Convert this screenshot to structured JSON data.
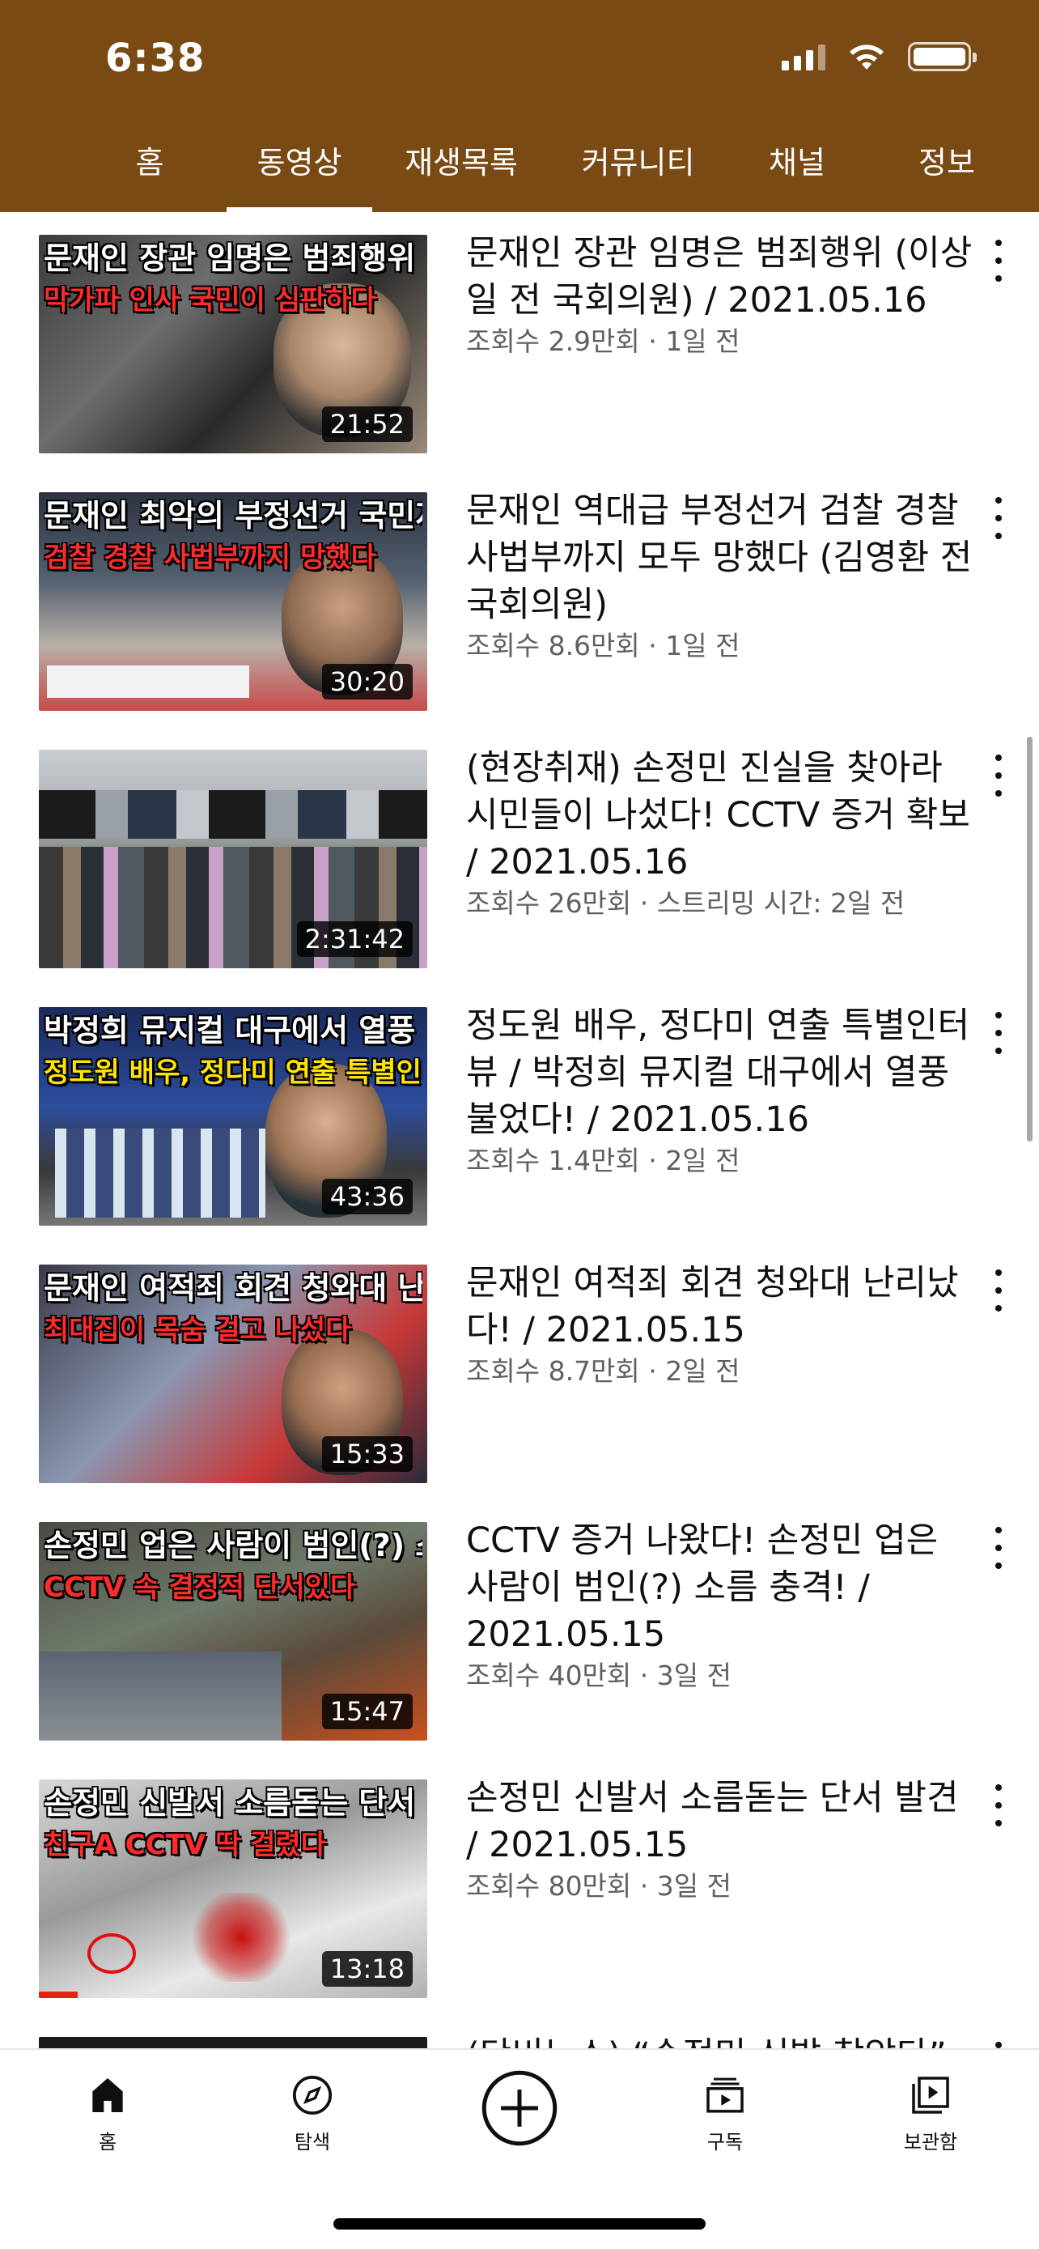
{
  "status_bar": {
    "time": "6:38"
  },
  "tabs": [
    {
      "label": "홈"
    },
    {
      "label": "동영상"
    },
    {
      "label": "재생목록"
    },
    {
      "label": "커뮤니티"
    },
    {
      "label": "채널"
    },
    {
      "label": "정보"
    }
  ],
  "active_tab": "동영상",
  "videos": [
    {
      "thumb_headline": "문재인 장관 임명은 범죄행위",
      "thumb_subline": "막가파 인사 국민이 심판하다",
      "duration": "21:52",
      "title": "문재인 장관 임명은 범죄행위 (이상일 전 국회의원) / 2021.05.16",
      "meta": "조회수 2.9만회 · 1일 전"
    },
    {
      "thumb_headline": "문재인 최악의 부정선거 국민저항 시작",
      "thumb_subline": "검찰 경찰 사법부까지 망했다",
      "duration": "30:20",
      "title": "문재인 역대급 부정선거 검찰 경찰 사법부까지 모두 망했다 (김영환 전 국회의원)",
      "meta": "조회수 8.6만회 · 1일 전"
    },
    {
      "thumb_headline": "",
      "thumb_subline": "",
      "duration": "2:31:42",
      "title": "(현장취재) 손정민 진실을 찾아라 시민들이 나섰다! CCTV 증거 확보 / 2021.05.16",
      "meta": "조회수 26만회 · 스트리밍 시간: 2일 전"
    },
    {
      "thumb_headline": "박정희 뮤지컬 대구에서 열풍 불었다",
      "thumb_subline": "정도원 배우, 정다미 연출 특별인터뷰",
      "duration": "43:36",
      "title": "정도원 배우, 정다미 연출 특별인터뷰 / 박정희 뮤지컬 대구에서 열풍 불었다! / 2021.05.16",
      "meta": "조회수 1.4만회 · 2일 전"
    },
    {
      "thumb_headline": "문재인 여적죄 회견 청와대 난리 났다",
      "thumb_subline": "최대집이 목숨 걸고 나섰다",
      "duration": "15:33",
      "title": "문재인 여적죄 회견 청와대 난리났다! / 2021.05.15",
      "meta": "조회수 8.7만회 · 2일 전"
    },
    {
      "thumb_headline": "손정민 업은 사람이 범인(?) 소름 충격",
      "thumb_subline": "CCTV 속 결정적 단서있다",
      "duration": "15:47",
      "title": "CCTV 증거 나왔다! 손정민 업은 사람이 범인(?) 소름 충격! / 2021.05.15",
      "meta": "조회수 40만회 · 3일 전"
    },
    {
      "thumb_headline": "손정민 신발서 소름돋는 단서 발견",
      "thumb_subline": "친구A CCTV 딱 걸렸다",
      "duration": "13:18",
      "title": "손정민 신발서 소름돋는 단서 발견 / 2021.05.15",
      "meta": "조회수 80만회 · 3일 전"
    },
    {
      "thumb_headline": "",
      "thumb_subline": "",
      "duration": "",
      "title": "(단비뉴스) “손정민 신발 찾았다”",
      "meta": ""
    }
  ],
  "bottom_nav": [
    {
      "label": "홈",
      "icon": "home-icon"
    },
    {
      "label": "탐색",
      "icon": "compass-icon"
    },
    {
      "label": "",
      "icon": "add-icon"
    },
    {
      "label": "구독",
      "icon": "subscriptions-icon"
    },
    {
      "label": "보관함",
      "icon": "library-icon"
    }
  ],
  "colors": {
    "header_bg": "#7a4a15",
    "progress_red": "#e62117"
  }
}
